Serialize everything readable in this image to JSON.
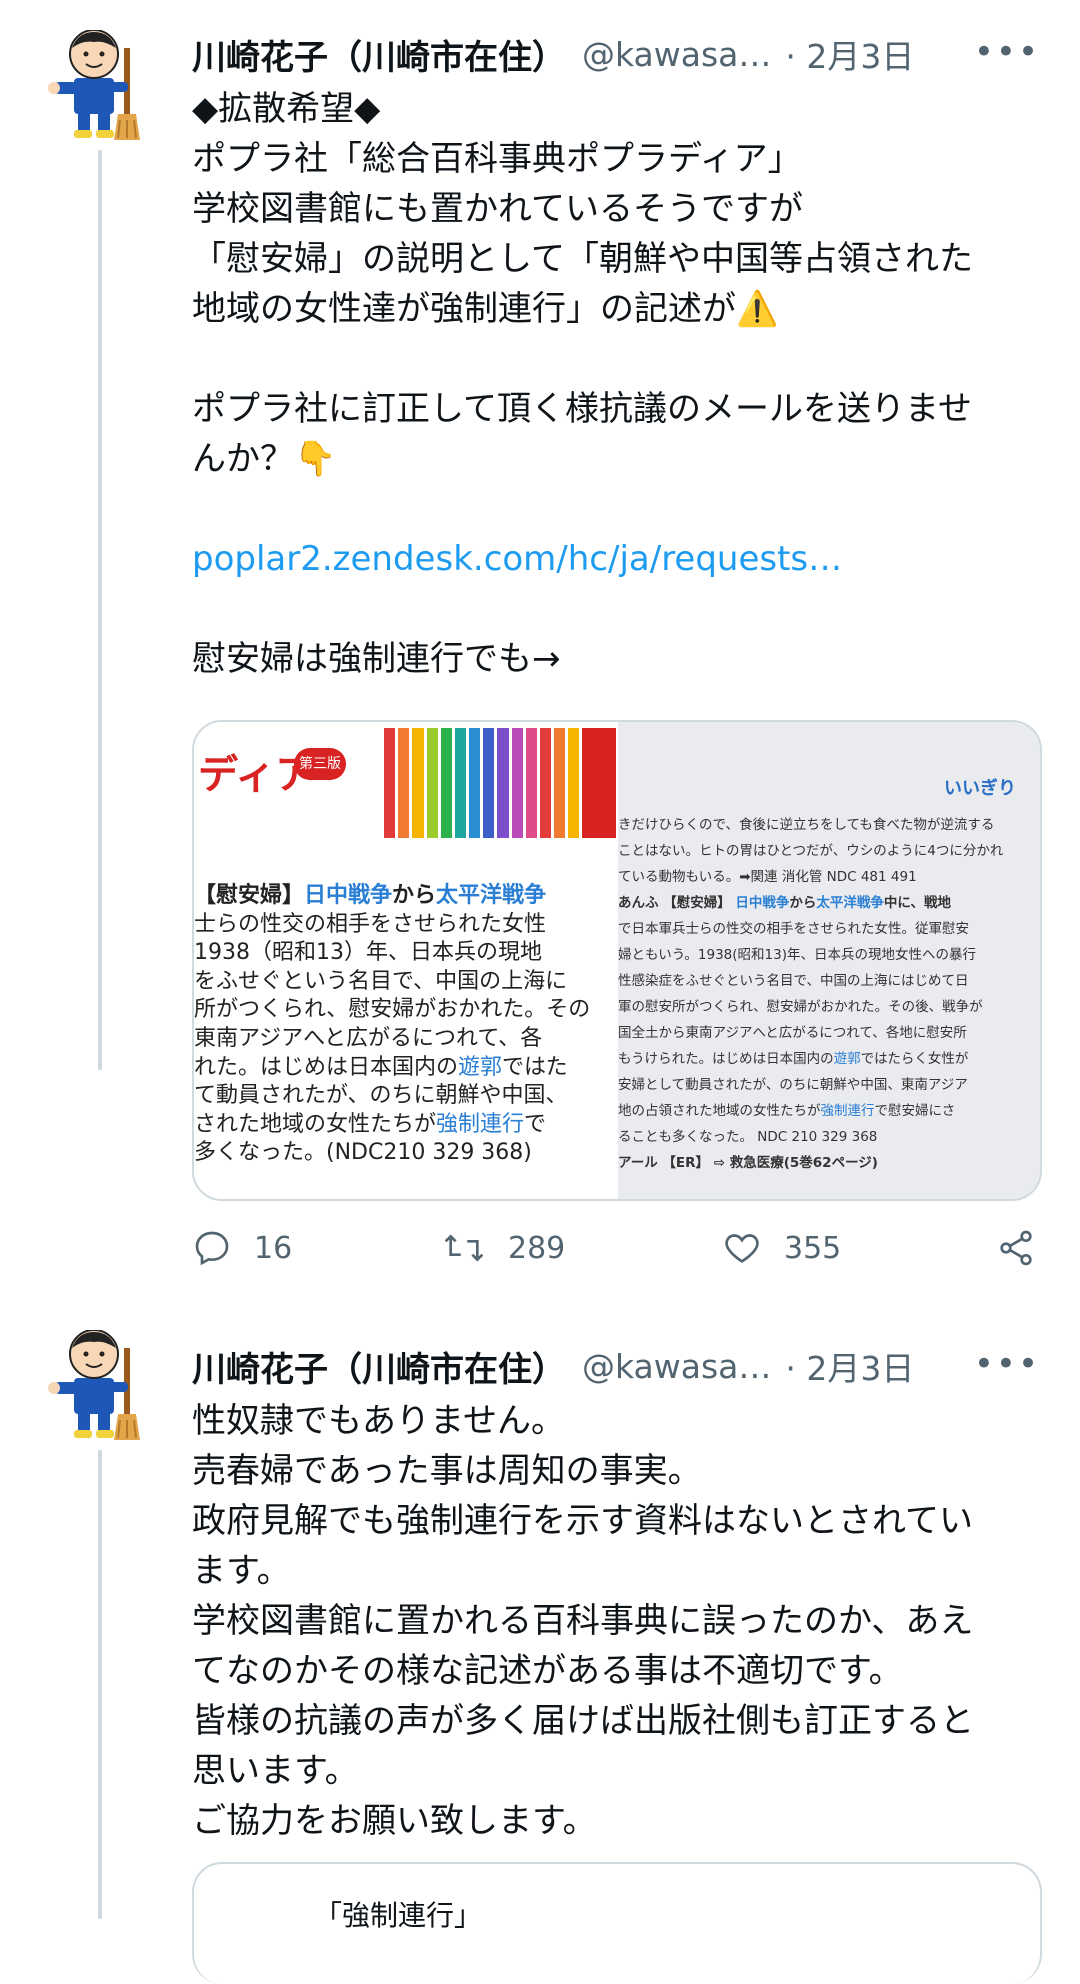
{
  "tweets": [
    {
      "author": {
        "name": "川崎花子（川崎市在住）",
        "handle": "@kawasa…",
        "date": "· 2月3日"
      },
      "more_label": "•••",
      "lines": [
        "◆拡散希望◆",
        "ポプラ社「総合百科事典ポプラディア」",
        "学校図書館にも置かれているそうですが",
        "「慰安婦」の説明として「朝鮮や中国等占領された",
        "地域の女性達が強制連行」の記述が⚠️",
        "",
        "ポプラ社に訂正して頂く様抗議のメールを送りませ",
        "んか？👇",
        "",
        "poplar2.zendesk.com/hc/ja/requests…",
        "",
        "慰安婦は強制連行でも→"
      ],
      "media": {
        "left": {
          "header": "ディア",
          "badge": "第三版",
          "lines": [
            "【慰安婦】日中戦争から太平洋戦争",
            "士らの性交の相手をさせられた女性",
            "1938（昭和13）年、日本兵の現地",
            "をふせぐという名目で、中国の上海に",
            "所がつくられ、慰安婦がおかれた。その",
            "東南アジアへと広がるにつれて、各",
            "れた。はじめは日本国内の遊郭ではた",
            "て動員されたが、のちに朝鮮や中国、",
            "された地域の女性たちが強制連行で",
            "多くなった。(NDC210 329 368)"
          ]
        },
        "right": {
          "tab_label": "いいぎり",
          "lines": [
            "きだけひらくので、食後に逆立ちをしても食べた物が逆流する",
            "ことはない。ヒトの胃はひとつだが、ウシのように4つに分かれ",
            "ている動物もいる。➡関連 消化管 NDC 481 491",
            "あんふ 【慰安婦】 日中戦争から太平洋戦争中に、戦地",
            "で日本軍兵士らの性交の相手をさせられた女性。従軍慰安",
            "婦ともいう。1938(昭和13)年、日本兵の現地女性への暴行",
            "性感染症をふせぐという名目で、中国の上海にはじめて日",
            "軍の慰安所がつくられ、慰安婦がおかれた。その後、戦争が",
            "国全土から東南アジアへと広がるにつれて、各地に慰安所",
            "もうけられた。はじめは日本国内の遊郭ではたらく女性が",
            "安婦として動員されたが、のちに朝鮮や中国、東南アジア",
            "地の占領された地域の女性たちが強制連行で慰安婦にさ",
            "ることも多くなった。 NDC 210 329 368",
            "アール 【ER】 ⇨ 救急医療(5巻62ページ)"
          ]
        }
      },
      "stats": {
        "replies": "16",
        "retweets": "289",
        "likes": "355"
      }
    },
    {
      "author": {
        "name": "川崎花子（川崎市在住）",
        "handle": "@kawasa…",
        "date": "· 2月3日"
      },
      "more_label": "•••",
      "lines": [
        "性奴隷でもありません。",
        "売春婦であった事は周知の事実。",
        "政府見解でも強制連行を示す資料はないとされてい",
        "ます。",
        "学校図書館に置かれる百科事典に誤ったのか、あえ",
        "てなのかその様な記述がある事は不適切です。",
        "皆様の抗議の声が多く届けば出版社側も訂正すると",
        "思います。",
        "ご協力をお願い致します。"
      ],
      "quote_preview": "「強制連行」"
    }
  ],
  "colors": {
    "text": "#0f1419",
    "muted": "#536471",
    "link": "#1d9bf0",
    "border": "#cfd9de",
    "highlight": "#2a7fd4"
  }
}
